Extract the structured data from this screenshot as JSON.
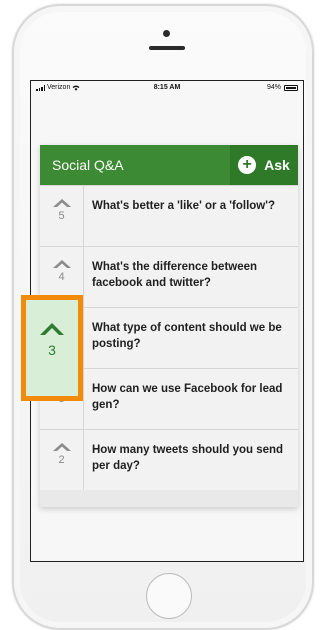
{
  "status_bar": {
    "carrier": "Verizon",
    "time": "8:15 AM",
    "battery": "94%"
  },
  "header": {
    "title": "Social Q&A",
    "ask_label": "Ask"
  },
  "questions": [
    {
      "votes": "5",
      "text": "What's better a 'like' or a 'follow'?"
    },
    {
      "votes": "4",
      "text": "What's the difference between facebook and twitter?"
    },
    {
      "votes": "3",
      "text": "What type of content should we be posting?"
    },
    {
      "votes": "3",
      "text": "How can we use Facebook for lead gen?"
    },
    {
      "votes": "2",
      "text": "How many tweets should you send per day?"
    }
  ],
  "highlight": {
    "votes": "3",
    "color": "#f28b0c"
  },
  "colors": {
    "header_green": "#3c8a34",
    "ask_green": "#2f7a29",
    "highlight_orange": "#f28b0c"
  },
  "icons": [
    "upvote-chevron-icon",
    "plus-circle-icon",
    "wifi-icon",
    "battery-icon"
  ]
}
